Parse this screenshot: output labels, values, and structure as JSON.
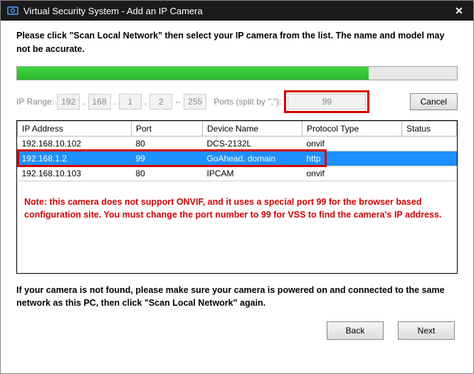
{
  "titlebar": {
    "title": "Virtual Security System - Add an IP Camera"
  },
  "instruction": "Please click \"Scan Local Network\" then select your IP camera from the list. The name and model may not be accurate.",
  "iprange": {
    "label": "IP Range:",
    "o1": "192",
    "o2": "168",
    "o3": "1",
    "o4a": "2",
    "dash": "--",
    "o4b": "255",
    "ports_label": "Ports (split by \",\"):",
    "ports_value": "99"
  },
  "cancel_label": "Cancel",
  "table": {
    "headers": {
      "ip": "IP Address",
      "port": "Port",
      "device": "Device Name",
      "proto": "Protocol Type",
      "status": "Status"
    },
    "rows": [
      {
        "ip": "192.168.10.102",
        "port": "80",
        "device": "DCS-2132L",
        "proto": "onvif",
        "status": ""
      },
      {
        "ip": "192.168.1.2",
        "port": "99",
        "device": "GoAhead, domain",
        "proto": "http",
        "status": ""
      },
      {
        "ip": "192.168.10.103",
        "port": "80",
        "device": "IPCAM",
        "proto": "onvif",
        "status": ""
      }
    ],
    "selected_index": 1
  },
  "note": "Note: this camera does not support ONVIF, and it uses a special port 99 for the browser based configuration site. You must change the port number to 99 for VSS to find the camera's IP address.",
  "footer": "If your camera is not found, please make sure your camera is powered on and connected to the same network as this PC, then click \"Scan Local Network\" again.",
  "back_label": "Back",
  "next_label": "Next"
}
